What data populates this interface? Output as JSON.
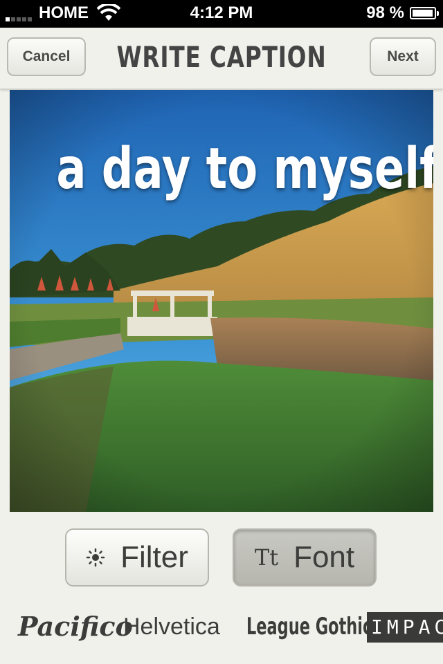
{
  "status_bar": {
    "carrier": "HOME",
    "time": "4:12 PM",
    "battery_percent": "98 %",
    "battery_level": 0.98,
    "signal_bars_filled": 1,
    "signal_bars_total": 5
  },
  "navbar": {
    "cancel_label": "Cancel",
    "title": "WRITE CAPTION",
    "next_label": "Next"
  },
  "photo": {
    "caption": "a day to myself"
  },
  "toolbar": {
    "filter_label": "Filter",
    "filter_icon": "sun-icon",
    "font_label": "Font",
    "font_icon_text": "Tt",
    "active_tab": "Font"
  },
  "fonts": [
    "Pacifico",
    "Helvetica",
    "League Gothic",
    "IMPAC"
  ],
  "colors": {
    "background": "#f1f1ec",
    "status_bar": "#000000",
    "active_button": "#bdbdb6"
  }
}
